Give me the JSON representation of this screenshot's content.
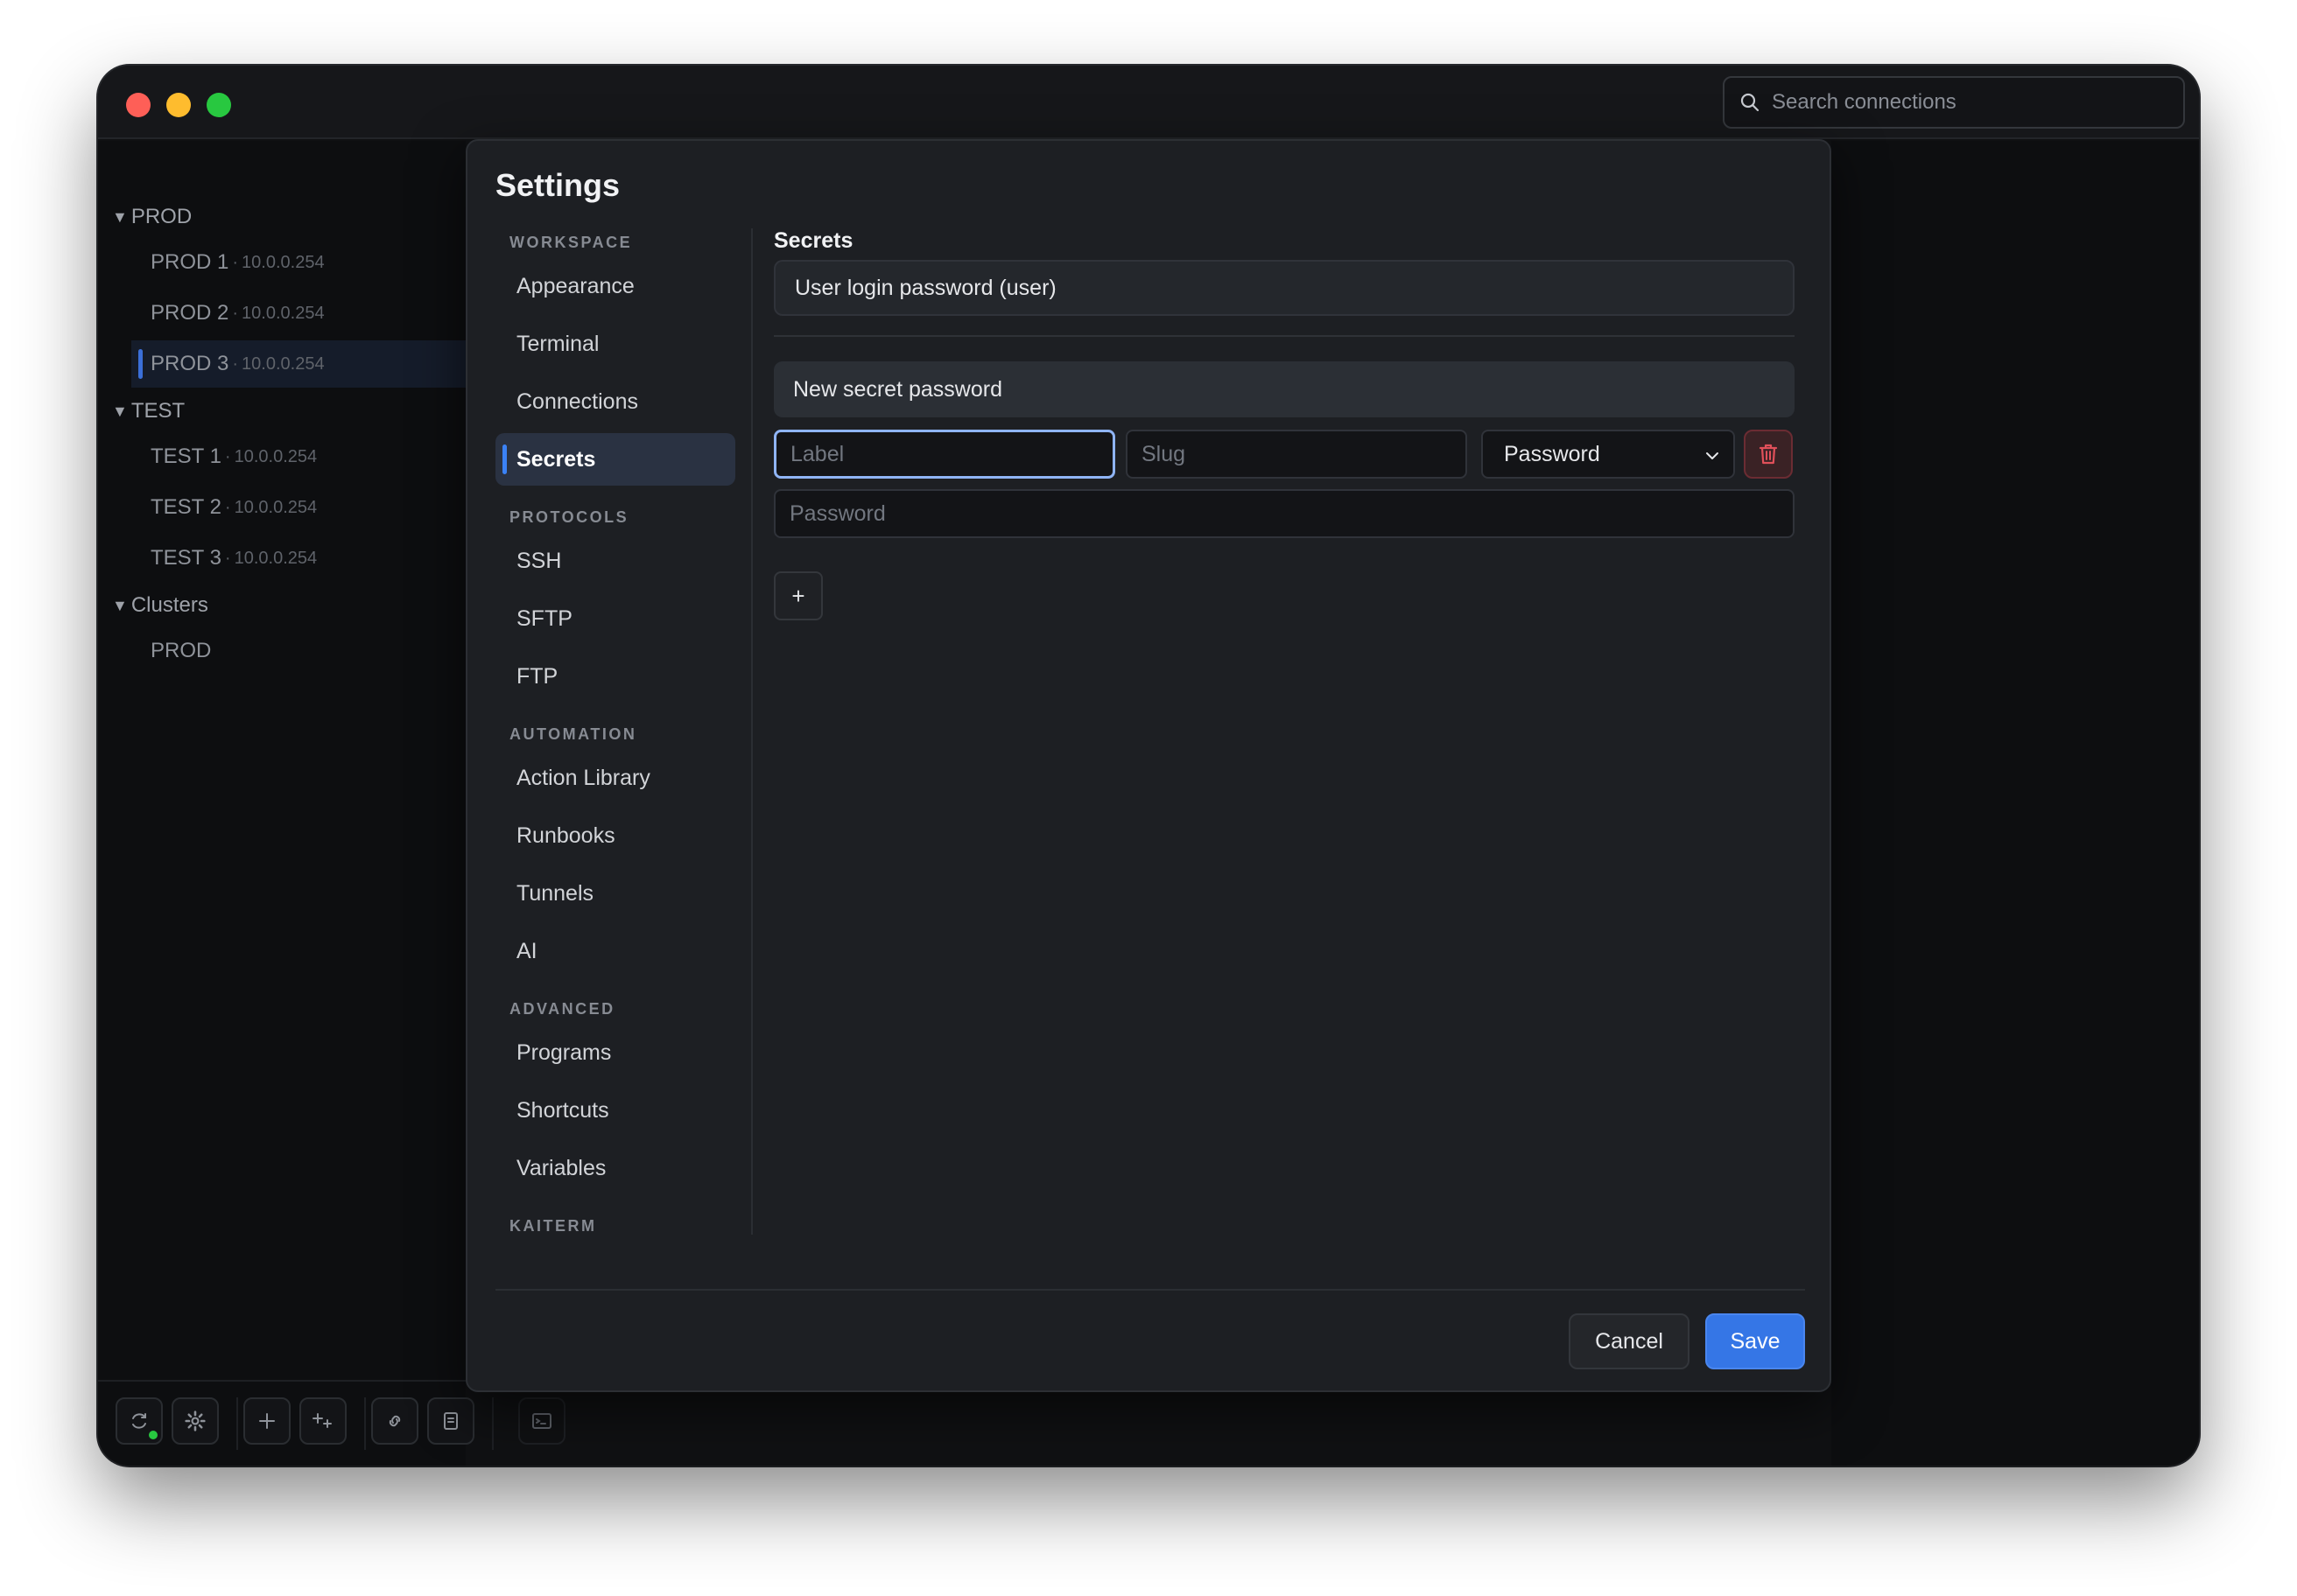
{
  "search": {
    "placeholder": "Search connections"
  },
  "sidebar": {
    "groups": [
      {
        "name": "PROD",
        "items": [
          {
            "name": "PROD 1",
            "ip": "10.0.0.254"
          },
          {
            "name": "PROD 2",
            "ip": "10.0.0.254"
          },
          {
            "name": "PROD 3",
            "ip": "10.0.0.254",
            "active": true
          }
        ]
      },
      {
        "name": "TEST",
        "items": [
          {
            "name": "TEST 1",
            "ip": "10.0.0.254"
          },
          {
            "name": "TEST 2",
            "ip": "10.0.0.254"
          },
          {
            "name": "TEST 3",
            "ip": "10.0.0.254"
          }
        ]
      },
      {
        "name": "Clusters",
        "items": [
          {
            "name": "PROD"
          }
        ]
      }
    ],
    "separator": "·",
    "status_color": "#28c840"
  },
  "toolbar": {
    "icons": [
      "sync-icon",
      "gear-icon",
      "plus-icon",
      "add-multiple-icon",
      "link-icon",
      "bookmark-icon",
      "terminal-icon"
    ]
  },
  "settings": {
    "title": "Settings",
    "nav": {
      "sections": [
        {
          "label": "WORKSPACE",
          "items": [
            "Appearance",
            "Terminal",
            "Connections",
            "Secrets"
          ]
        },
        {
          "label": "PROTOCOLS",
          "items": [
            "SSH",
            "SFTP",
            "FTP"
          ]
        },
        {
          "label": "AUTOMATION",
          "items": [
            "Action Library",
            "Runbooks",
            "Tunnels",
            "AI"
          ]
        },
        {
          "label": "ADVANCED",
          "items": [
            "Programs",
            "Shortcuts",
            "Variables"
          ]
        },
        {
          "label": "KAITERM",
          "items": []
        }
      ],
      "active": "Secrets"
    },
    "secrets": {
      "title": "Secrets",
      "existing": "User login password (user)",
      "new_title": "New secret password",
      "label_placeholder": "Label",
      "slug_placeholder": "Slug",
      "type_value": "Password",
      "password_placeholder": "Password",
      "add_label": "+"
    },
    "footer": {
      "cancel": "Cancel",
      "save": "Save"
    },
    "colors": {
      "accent": "#3b82f6",
      "save_button": "#3576e6",
      "danger": "#e0505a"
    }
  }
}
